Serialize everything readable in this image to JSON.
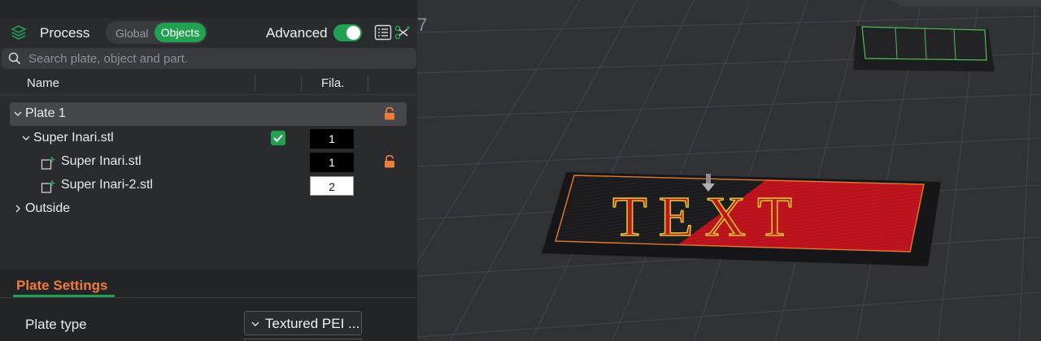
{
  "process": {
    "title": "Process",
    "scope_global": "Global",
    "scope_objects": "Objects",
    "advanced_label": "Advanced",
    "advanced_on": true,
    "icons": [
      "layers-icon",
      "list-icon",
      "cut-icon"
    ]
  },
  "search": {
    "placeholder": "Search plate, object and part."
  },
  "columns": {
    "name": "Name",
    "fila": "Fila."
  },
  "tree": {
    "plate": "Plate 1",
    "object": {
      "label": "Super Inari.stl",
      "checked": true,
      "fila": "1"
    },
    "parts": [
      {
        "label": "Super Inari.stl",
        "fila": "1"
      },
      {
        "label": "Super Inari-2.stl",
        "fila": "2"
      }
    ],
    "outside": "Outside"
  },
  "plate_settings": {
    "title": "Plate Settings",
    "plate_type_label": "Plate type",
    "plate_type_value": "Textured PEI ..."
  },
  "viewport": {
    "model_text": "TEXT",
    "colors": {
      "filament_1": "#1a1a1a",
      "filament_2": "#c0141e",
      "text_outline": "#d8c431",
      "bed_grid": "#4a4b50",
      "selection": "#f07a3c"
    }
  },
  "colors": {
    "accent": "#22a153",
    "warning": "#f07a3c"
  }
}
